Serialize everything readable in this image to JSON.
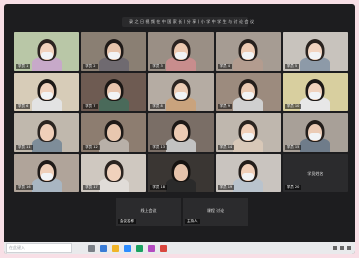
{
  "recording_bar": {
    "text": "录 之 日 视 频 在 中 国 家 长 ( 分 享 ) 小 学 中 学 生 与 讨 论 会 议"
  },
  "tiles": [
    {
      "name": "学员 1",
      "bg": "#b9c7a7",
      "skin": "#f1d2bd",
      "hair": "#2b2320",
      "mask": true,
      "shirt": "#c7a9c9"
    },
    {
      "name": "学员 2",
      "bg": "#8a7f73",
      "skin": "#e6c3ab",
      "hair": "#1f1a18",
      "mask": true,
      "shirt": "#6f6a70"
    },
    {
      "name": "学员 3",
      "bg": "#9a8f85",
      "skin": "#ecc9b1",
      "hair": "#2a2220",
      "mask": true,
      "shirt": "#c88d8d"
    },
    {
      "name": "学员 4",
      "bg": "#a69c93",
      "skin": "#edcbb4",
      "hair": "#26201d",
      "mask": true,
      "shirt": "#b39c8f"
    },
    {
      "name": "学员 5",
      "bg": "#c8c3bd",
      "skin": "#f2d4c0",
      "hair": "#2a231f",
      "mask": true,
      "shirt": "#8d9aa8"
    },
    {
      "name": "学员 6",
      "bg": "#d7ccb8",
      "skin": "#efd1bd",
      "hair": "#1c1816",
      "mask": true,
      "shirt": "#e3e3e3"
    },
    {
      "name": "学员 7",
      "bg": "#6e5b52",
      "skin": "#e7c4ad",
      "hair": "#1b1715",
      "mask": true,
      "shirt": "#4a6a5a"
    },
    {
      "name": "学员 8",
      "bg": "#b5aca3",
      "skin": "#edcdb6",
      "hair": "#2b2421",
      "mask": true,
      "shirt": "#c9a37d"
    },
    {
      "name": "学员 9",
      "bg": "#9c8b7e",
      "skin": "#eacab3",
      "hair": "#231d1a",
      "mask": true,
      "shirt": "#d0d0d0"
    },
    {
      "name": "学员 10",
      "bg": "#d8cf9f",
      "skin": "#f0d2bd",
      "hair": "#1d1917",
      "mask": true,
      "shirt": "#e7e7e7"
    },
    {
      "name": "学员 11",
      "bg": "#c0b8ad",
      "skin": "#efcfb9",
      "hair": "#2a2420",
      "mask": false,
      "shirt": "#7e8d99"
    },
    {
      "name": "学员 12",
      "bg": "#8d7d70",
      "skin": "#e8c7af",
      "hair": "#1e1a18",
      "mask": false,
      "shirt": "#b8b0a8"
    },
    {
      "name": "学员 13",
      "bg": "#7a6e66",
      "skin": "#eccbb4",
      "hair": "#1c1816",
      "mask": false,
      "shirt": "#c2c2c2"
    },
    {
      "name": "学员 14",
      "bg": "#bfb7ae",
      "skin": "#f0d0ba",
      "hair": "#2a2420",
      "mask": true,
      "shirt": "#d8c8b8"
    },
    {
      "name": "学员 15",
      "bg": "#a8a098",
      "skin": "#ebcbb5",
      "hair": "#231e1b",
      "mask": true,
      "shirt": "#6f7c8a"
    },
    {
      "name": "学员 16",
      "bg": "#b0a49a",
      "skin": "#efcfb9",
      "hair": "#1f1a18",
      "mask": true,
      "shirt": "#a9b6c2"
    },
    {
      "name": "学员 17",
      "bg": "#cfc8c0",
      "skin": "#f0d1bc",
      "hair": "#2a231f",
      "mask": false,
      "shirt": "#e0dcd8"
    },
    {
      "name": "学员 18",
      "bg": "#3a3633",
      "skin": "#e5c3ab",
      "hair": "#151210",
      "mask": false,
      "shirt": "#2a2a2a"
    },
    {
      "name": "学员 19",
      "bg": "#c9c4bf",
      "skin": "#efcfb9",
      "hair": "#221d1a",
      "mask": true,
      "shirt": "#b9c3cd"
    },
    {
      "name": "学员 20",
      "dark": true,
      "label": "学员姓名"
    }
  ],
  "bottom_tiles": [
    {
      "label": "线上会议",
      "name": "会议名称"
    },
    {
      "label": "课程 讨论",
      "name": "主持人"
    }
  ],
  "taskbar": {
    "search_placeholder": "在此键入"
  },
  "colors": {
    "screen": "#1d1d1f",
    "taskbar": "#e9eaec",
    "rec": "#e53935"
  }
}
